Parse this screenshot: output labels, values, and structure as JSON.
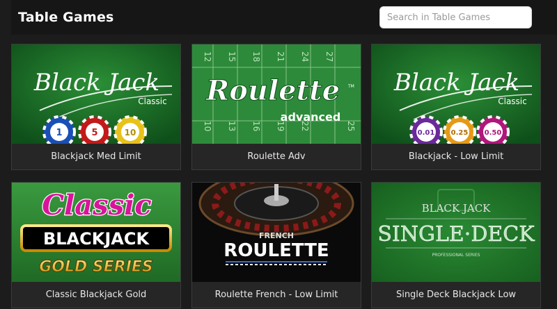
{
  "header": {
    "title": "Table Games",
    "search_placeholder": "Search in Table Games"
  },
  "games": [
    {
      "label": "Blackjack Med Limit",
      "art": {
        "line1": "Black Jack",
        "line2": "Classic",
        "chips": [
          "1",
          "5",
          "10"
        ]
      }
    },
    {
      "label": "Roulette Adv",
      "art": {
        "line1": "Roulette",
        "line2": "advanced",
        "mark": "TM",
        "numbers": [
          "12",
          "15",
          "18",
          "21",
          "24",
          "27",
          "10",
          "13",
          "16",
          "19",
          "22",
          "25"
        ]
      }
    },
    {
      "label": "Blackjack - Low Limit",
      "art": {
        "line1": "Black Jack",
        "line2": "Classic",
        "chips": [
          "0.01",
          "0.25",
          "0.50"
        ]
      }
    },
    {
      "label": "Classic Blackjack Gold",
      "art": {
        "line1": "Classic",
        "line2": "BLACKJACK",
        "line3": "GOLD SERIES"
      }
    },
    {
      "label": "Roulette French - Low Limit",
      "art": {
        "line1": "FRENCH",
        "line2": "ROULETTE"
      }
    },
    {
      "label": "Single Deck Blackjack Low",
      "art": {
        "line1": "BLACK JACK",
        "line2": "SINGLE·DECK",
        "line3": "PROFESSIONAL SERIES"
      }
    }
  ],
  "colors": {
    "page_bg": "#1c1c1c",
    "header_bg": "#161616",
    "felt_green": "#1d7a2c",
    "felt_dark": "#0f4f1a",
    "caption_bg": "#262626"
  }
}
